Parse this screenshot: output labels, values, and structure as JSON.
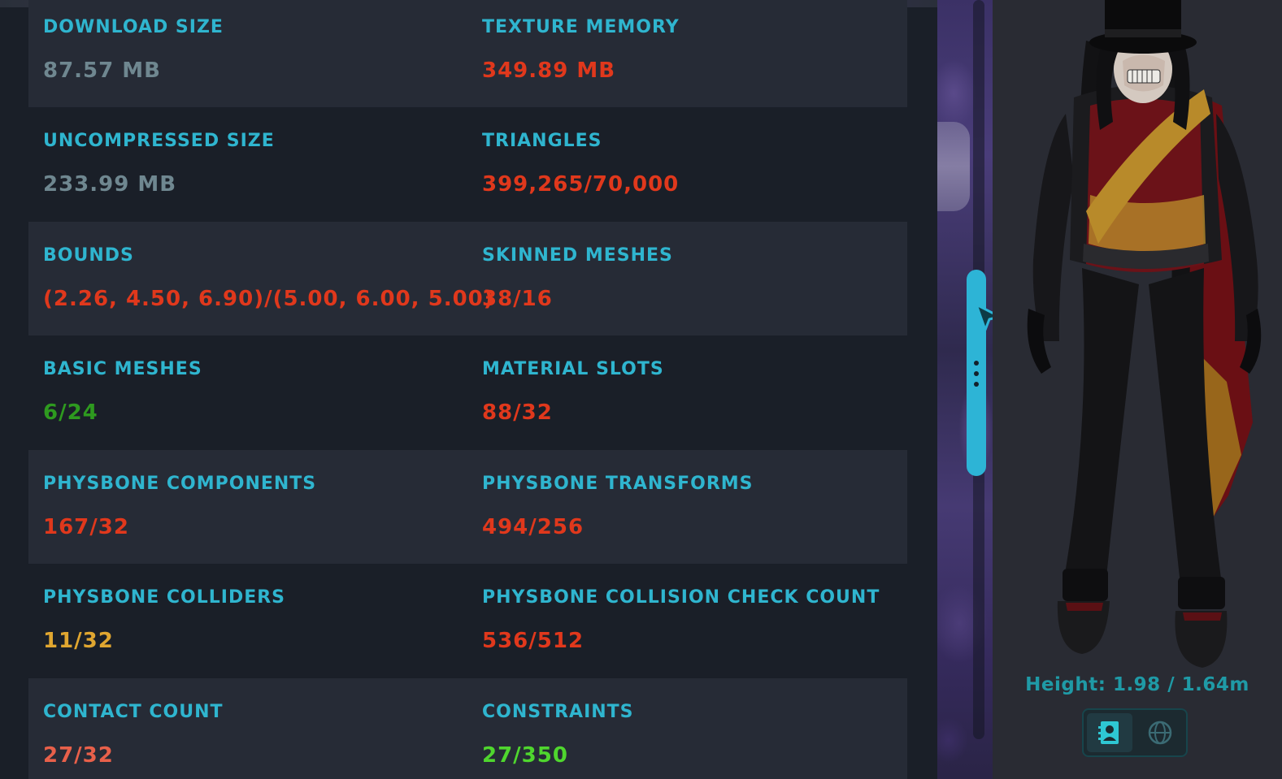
{
  "stats": [
    {
      "label": "DOWNLOAD SIZE",
      "value": "87.57 MB",
      "color": "#6f8790"
    },
    {
      "label": "TEXTURE MEMORY",
      "value": "349.89 MB",
      "color": "#e0381c"
    },
    {
      "label": "UNCOMPRESSED SIZE",
      "value": "233.99 MB",
      "color": "#6f8790"
    },
    {
      "label": "TRIANGLES",
      "value": "399,265/70,000",
      "color": "#e0381c"
    },
    {
      "label": "BOUNDS",
      "value": "(2.26, 4.50, 6.90)/(5.00, 6.00, 5.00)",
      "color": "#e0381c"
    },
    {
      "label": "SKINNED MESHES",
      "value": "38/16",
      "color": "#e0381c"
    },
    {
      "label": "BASIC MESHES",
      "value": "6/24",
      "color": "#2e9a1f"
    },
    {
      "label": "MATERIAL SLOTS",
      "value": "88/32",
      "color": "#e0381c"
    },
    {
      "label": "PHYSBONE COMPONENTS",
      "value": "167/32",
      "color": "#e0381c"
    },
    {
      "label": "PHYSBONE TRANSFORMS",
      "value": "494/256",
      "color": "#e0381c"
    },
    {
      "label": "PHYSBONE COLLIDERS",
      "value": "11/32",
      "color": "#e0a630"
    },
    {
      "label": "PHYSBONE COLLISION CHECK COUNT",
      "value": "536/512",
      "color": "#e0381c"
    },
    {
      "label": "CONTACT COUNT",
      "value": "27/32",
      "color": "#e8604a"
    },
    {
      "label": "CONSTRAINTS",
      "value": "27/350",
      "color": "#4fd62e"
    }
  ],
  "avatar": {
    "height_text": "Height: 1.98 / 1.64m"
  },
  "icons": {
    "scroll_grip": "vertical-dots-icon",
    "cursor": "pointer-cursor-icon",
    "avatar_view": "avatar-card-icon",
    "world_view": "globe-icon"
  },
  "colors": {
    "label": "#2fb5cf",
    "accent": "#2db4d6",
    "panel_dark": "#1a1f28",
    "panel_row": "#262b36"
  }
}
